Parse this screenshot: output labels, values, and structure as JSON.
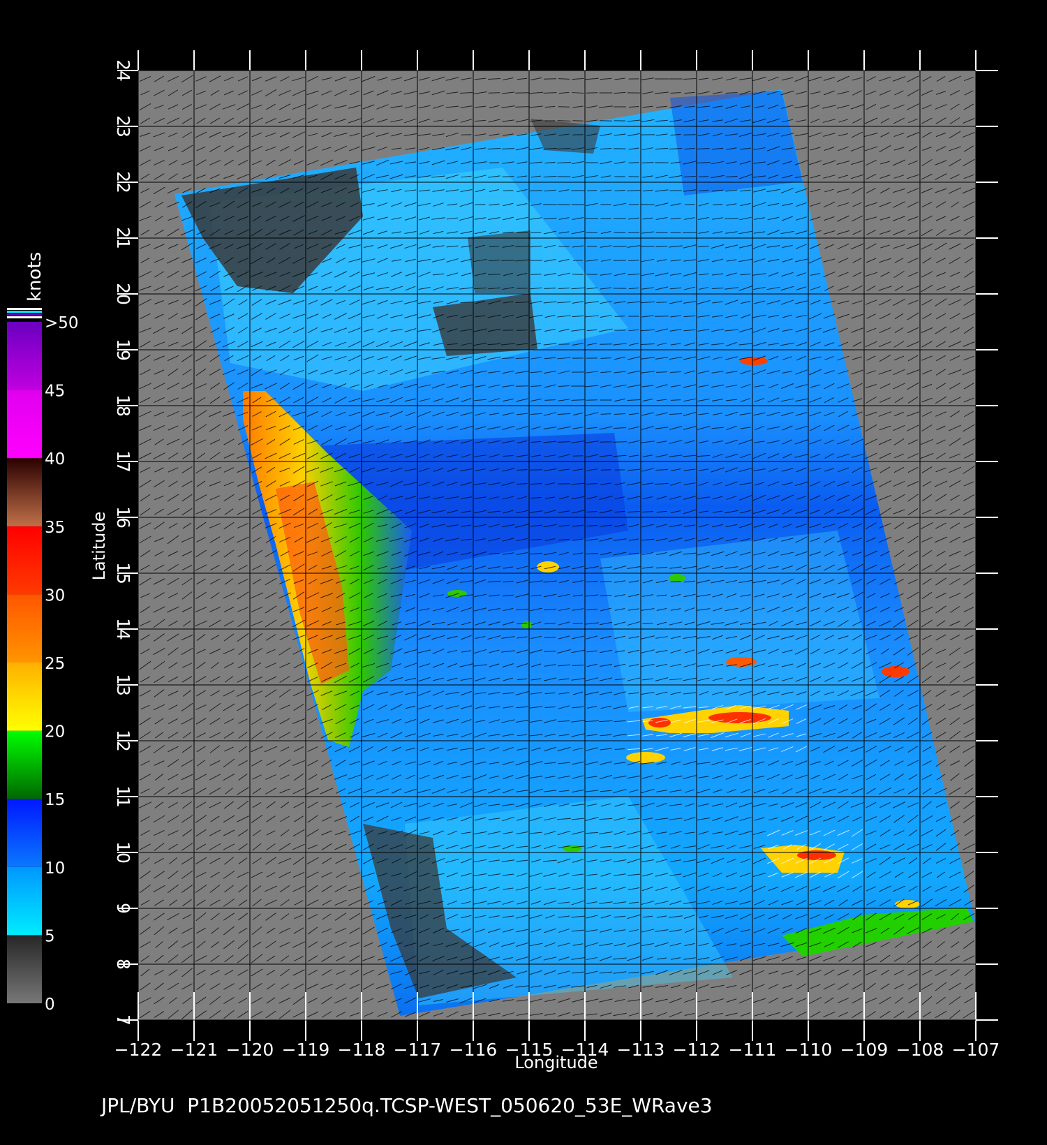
{
  "map": {
    "type": "wind-speed-swath",
    "x_axis": {
      "label": "Longitude",
      "ticks": [
        -122,
        -121,
        -120,
        -119,
        -118,
        -117,
        -116,
        -115,
        -114,
        -113,
        -112,
        -111,
        -110,
        -109,
        -108,
        -107
      ],
      "range": [
        -122,
        -107
      ]
    },
    "y_axis": {
      "label": "Latitude",
      "ticks": [
        7,
        8,
        9,
        10,
        11,
        12,
        13,
        14,
        15,
        16,
        17,
        18,
        19,
        20,
        21,
        22,
        23,
        24
      ],
      "range": [
        7,
        24
      ]
    },
    "grid": true,
    "colors": {
      "land_or_nodata": "#7f7f7f",
      "background": "#000000",
      "vectors_low": "#000000",
      "vectors_high": "#ffffff"
    }
  },
  "colorbar": {
    "title": "knots",
    "tick_labels": [
      "0",
      "5",
      "10",
      "15",
      "20",
      "25",
      "30",
      "35",
      "40",
      "45",
      ">50"
    ],
    "bands": [
      {
        "from": 0,
        "to": 5,
        "color_low": "#777777",
        "color_high": "#262626"
      },
      {
        "from": 5,
        "to": 10,
        "color_low": "#00ecff",
        "color_high": "#0097ff"
      },
      {
        "from": 10,
        "to": 15,
        "color_low": "#0a78ff",
        "color_high": "#0018ff"
      },
      {
        "from": 15,
        "to": 20,
        "color_low": "#006800",
        "color_high": "#00ff00"
      },
      {
        "from": 20,
        "to": 25,
        "color_low": "#ffff00",
        "color_high": "#ffb000"
      },
      {
        "from": 25,
        "to": 30,
        "color_low": "#ff9500",
        "color_high": "#ff5500"
      },
      {
        "from": 30,
        "to": 35,
        "color_low": "#ff3a00",
        "color_high": "#ff0000"
      },
      {
        "from": 35,
        "to": 40,
        "color_low": "#c07048",
        "color_high": "#2a0000"
      },
      {
        "from": 40,
        "to": 45,
        "color_low": "#ff00ff",
        "color_high": "#e000ee"
      },
      {
        "from": 45,
        "to": 50,
        "color_low": "#c000e0",
        "color_high": "#6a00c0"
      }
    ]
  },
  "footer": {
    "credit": "JPL/BYU  P1B20052051250q.TCSP-WEST_050620_53E_WRave3"
  }
}
